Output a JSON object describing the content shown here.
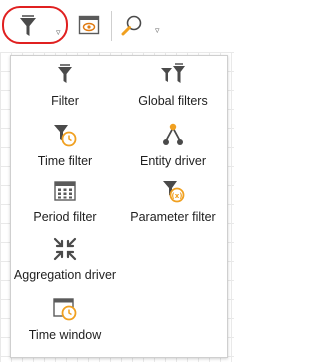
{
  "toolbar": {
    "filter_button": {
      "icon": "filter-icon",
      "caret": "▿"
    },
    "view_button": {
      "icon": "view-window-icon"
    },
    "search_button": {
      "icon": "magnifier-icon",
      "caret": "▿"
    }
  },
  "menu": {
    "items": [
      {
        "label": "Filter",
        "icon": "filter-icon"
      },
      {
        "label": "Global filters",
        "icon": "global-filters-icon"
      },
      {
        "label": "Time filter",
        "icon": "time-filter-icon"
      },
      {
        "label": "Entity driver",
        "icon": "entity-driver-icon"
      },
      {
        "label": "Period filter",
        "icon": "period-filter-icon"
      },
      {
        "label": "Parameter filter",
        "icon": "parameter-filter-icon"
      },
      {
        "label": "Aggregation driver",
        "icon": "aggregation-driver-icon"
      },
      {
        "label": "Time window",
        "icon": "time-window-icon"
      }
    ]
  },
  "colors": {
    "highlight": "#e02020",
    "accent_orange": "#f0a020",
    "icon_gray": "#5a5a5a"
  }
}
